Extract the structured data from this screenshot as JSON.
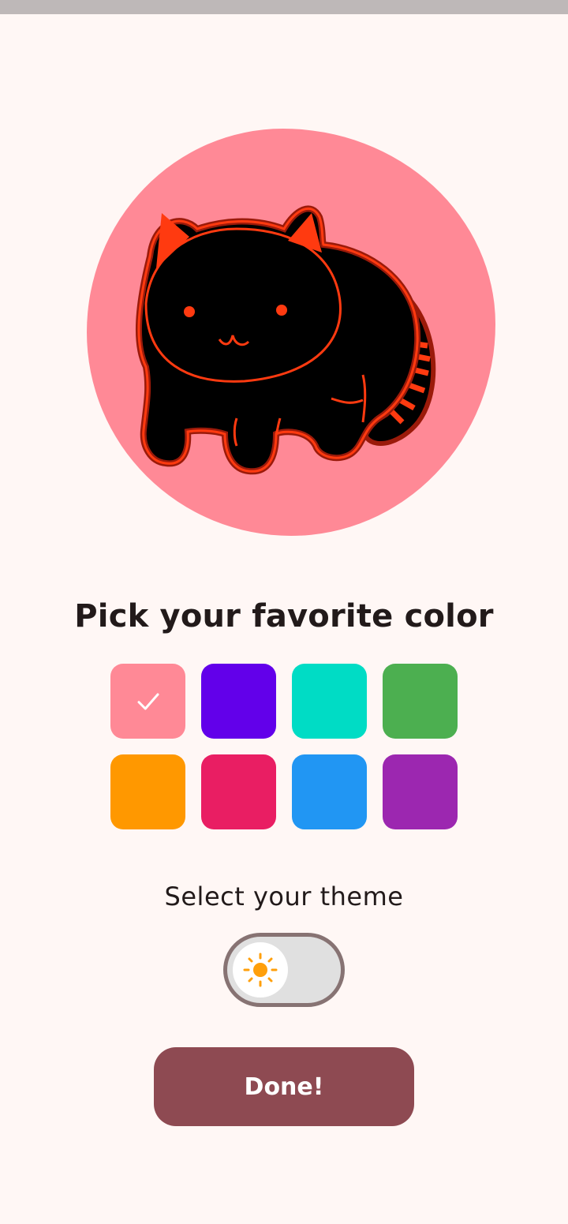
{
  "heading": "Pick your favorite color",
  "colors": {
    "swatches": [
      {
        "name": "pink",
        "hex": "#FF8996",
        "selected": true
      },
      {
        "name": "purple",
        "hex": "#6200EA",
        "selected": false
      },
      {
        "name": "teal",
        "hex": "#00DCC5",
        "selected": false
      },
      {
        "name": "green",
        "hex": "#4CAF50",
        "selected": false
      },
      {
        "name": "orange",
        "hex": "#FF9800",
        "selected": false
      },
      {
        "name": "crimson",
        "hex": "#E91E63",
        "selected": false
      },
      {
        "name": "blue",
        "hex": "#2196F3",
        "selected": false
      },
      {
        "name": "violet",
        "hex": "#9C27B0",
        "selected": false
      }
    ],
    "selected_icon": "check-icon"
  },
  "theme": {
    "label": "Select your theme",
    "mode": "light",
    "thumb_icon": "sun-icon",
    "thumb_icon_color": "#FF9F0A"
  },
  "avatar": {
    "icon": "black-cat-illustration",
    "background": "#FF8996"
  },
  "done_button": {
    "label": "Done!",
    "background": "#8E4A52"
  }
}
